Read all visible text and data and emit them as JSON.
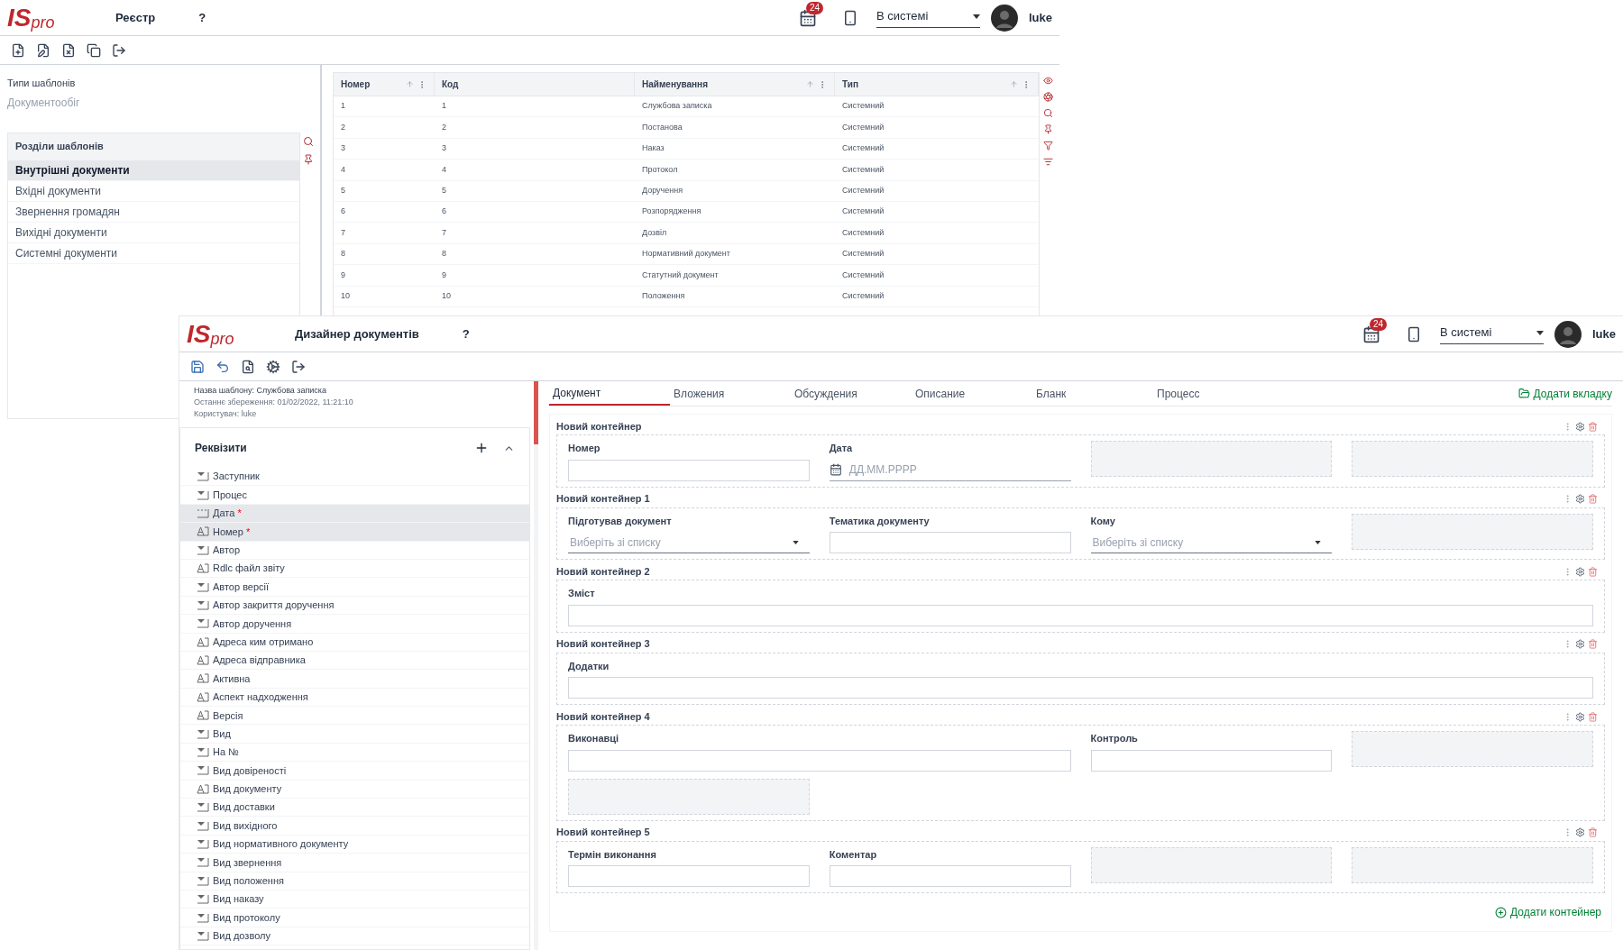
{
  "registry_window": {
    "logo": {
      "part_1": "IS",
      "part_2": "pro"
    },
    "menu": [
      "Реєстр",
      "?"
    ],
    "notifications": "24",
    "status": "В системі",
    "user": "luke",
    "types": {
      "label": "Типи шаблонів",
      "value": "Документообіг"
    },
    "sections": {
      "title": "Розділи шаблонів",
      "items": [
        {
          "label": "Внутрішні документи",
          "selected": true
        },
        {
          "label": "Вхідні документи",
          "selected": false
        },
        {
          "label": "Звернення громадян",
          "selected": false
        },
        {
          "label": "Вихідні документи",
          "selected": false
        },
        {
          "label": "Системні документи",
          "selected": false
        }
      ]
    },
    "table": {
      "columns": [
        {
          "label": "Номер",
          "sortable": true
        },
        {
          "label": "Код",
          "sortable": false
        },
        {
          "label": "Найменування",
          "sortable": true
        },
        {
          "label": "Тип",
          "sortable": true
        }
      ],
      "rows": [
        [
          "1",
          "1",
          "Службова записка",
          "Системний"
        ],
        [
          "2",
          "2",
          "Постанова",
          "Системний"
        ],
        [
          "3",
          "3",
          "Наказ",
          "Системний"
        ],
        [
          "4",
          "4",
          "Протокол",
          "Системний"
        ],
        [
          "5",
          "5",
          "Доручення",
          "Системний"
        ],
        [
          "6",
          "6",
          "Розпорядження",
          "Системний"
        ],
        [
          "7",
          "7",
          "Дозвіл",
          "Системний"
        ],
        [
          "8",
          "8",
          "Нормативний документ",
          "Системний"
        ],
        [
          "9",
          "9",
          "Статутний документ",
          "Системний"
        ],
        [
          "10",
          "10",
          "Положення",
          "Системний"
        ]
      ]
    }
  },
  "designer_window": {
    "logo": {
      "part_1": "IS",
      "part_2": "pro"
    },
    "menu": [
      "Дизайнер документів",
      "?"
    ],
    "notifications": "24",
    "status": "В системі",
    "user": "luke",
    "info": [
      "Назва шаблону: Службова записка",
      "Останнє збереження: 01/02/2022, 11:21:10",
      "Користувач: luke"
    ],
    "requisites": {
      "title": "Реквізити",
      "required_mark": "*",
      "items": [
        {
          "label": "Заступник",
          "kind": "list",
          "required": false,
          "selected": false
        },
        {
          "label": "Процес",
          "kind": "list",
          "required": false,
          "selected": false
        },
        {
          "label": "Дата",
          "kind": "date",
          "required": true,
          "selected": true
        },
        {
          "label": "Номер",
          "kind": "text",
          "required": true,
          "selected": true
        },
        {
          "label": "Автор",
          "kind": "list",
          "required": false,
          "selected": false
        },
        {
          "label": "Rdlc файл звіту",
          "kind": "text",
          "required": false,
          "selected": false
        },
        {
          "label": "Автор версії",
          "kind": "list",
          "required": false,
          "selected": false
        },
        {
          "label": "Автор закриття доручення",
          "kind": "list",
          "required": false,
          "selected": false
        },
        {
          "label": "Автор доручення",
          "kind": "list",
          "required": false,
          "selected": false
        },
        {
          "label": "Адреса ким отримано",
          "kind": "text",
          "required": false,
          "selected": false
        },
        {
          "label": "Адреса відправника",
          "kind": "text",
          "required": false,
          "selected": false
        },
        {
          "label": "Активна",
          "kind": "text",
          "required": false,
          "selected": false
        },
        {
          "label": "Аспект надходження",
          "kind": "text",
          "required": false,
          "selected": false
        },
        {
          "label": "Версія",
          "kind": "text",
          "required": false,
          "selected": false
        },
        {
          "label": "Вид",
          "kind": "list",
          "required": false,
          "selected": false
        },
        {
          "label": "На №",
          "kind": "list",
          "required": false,
          "selected": false
        },
        {
          "label": "Вид довіреності",
          "kind": "list",
          "required": false,
          "selected": false
        },
        {
          "label": "Вид документу",
          "kind": "text",
          "required": false,
          "selected": false
        },
        {
          "label": "Вид доставки",
          "kind": "list",
          "required": false,
          "selected": false
        },
        {
          "label": "Вид вихідного",
          "kind": "list",
          "required": false,
          "selected": false
        },
        {
          "label": "Вид нормативного документу",
          "kind": "list",
          "required": false,
          "selected": false
        },
        {
          "label": "Вид звернення",
          "kind": "list",
          "required": false,
          "selected": false
        },
        {
          "label": "Вид положення",
          "kind": "list",
          "required": false,
          "selected": false
        },
        {
          "label": "Вид наказу",
          "kind": "list",
          "required": false,
          "selected": false
        },
        {
          "label": "Вид протоколу",
          "kind": "list",
          "required": false,
          "selected": false
        },
        {
          "label": "Вид дозволу",
          "kind": "list",
          "required": false,
          "selected": false
        }
      ]
    },
    "tabs": [
      {
        "label": "Документ",
        "selected": true
      },
      {
        "label": "Вложения",
        "selected": false
      },
      {
        "label": "Обсуждения",
        "selected": false
      },
      {
        "label": "Описание",
        "selected": false
      },
      {
        "label": "Бланк",
        "selected": false
      },
      {
        "label": "Процесс",
        "selected": false
      }
    ],
    "add_tab": "Додати вкладку",
    "containers": [
      {
        "title": "Новий контейнер",
        "fields": [
          {
            "kind": "text",
            "label": "Номер"
          },
          {
            "kind": "date",
            "label": "Дата",
            "placeholder": "ДД.ММ.РРРР"
          },
          {
            "kind": "empty"
          },
          {
            "kind": "empty"
          }
        ]
      },
      {
        "title": "Новий контейнер 1",
        "fields": [
          {
            "kind": "select",
            "label": "Підготував документ",
            "placeholder": "Виберіть зі списку"
          },
          {
            "kind": "text",
            "label": "Тематика документу"
          },
          {
            "kind": "select",
            "label": "Кому",
            "placeholder": "Виберіть зі списку"
          },
          {
            "kind": "empty"
          }
        ]
      },
      {
        "title": "Новий контейнер 2",
        "fields": [
          {
            "kind": "wide",
            "label": "Зміст"
          }
        ]
      },
      {
        "title": "Новий контейнер 3",
        "fields": [
          {
            "kind": "wide",
            "label": "Додатки"
          }
        ]
      },
      {
        "title": "Новий контейнер 4",
        "fields": [
          {
            "kind": "double",
            "label": "Виконавці"
          },
          {
            "kind": "text",
            "label": "Контроль"
          },
          {
            "kind": "empty"
          },
          {
            "kind": "empty"
          }
        ]
      },
      {
        "title": "Новий контейнер 5",
        "fields": [
          {
            "kind": "text",
            "label": "Термін виконання"
          },
          {
            "kind": "text",
            "label": "Коментар"
          },
          {
            "kind": "empty"
          },
          {
            "kind": "empty"
          }
        ]
      }
    ],
    "add_container": "Додати контейнер"
  }
}
